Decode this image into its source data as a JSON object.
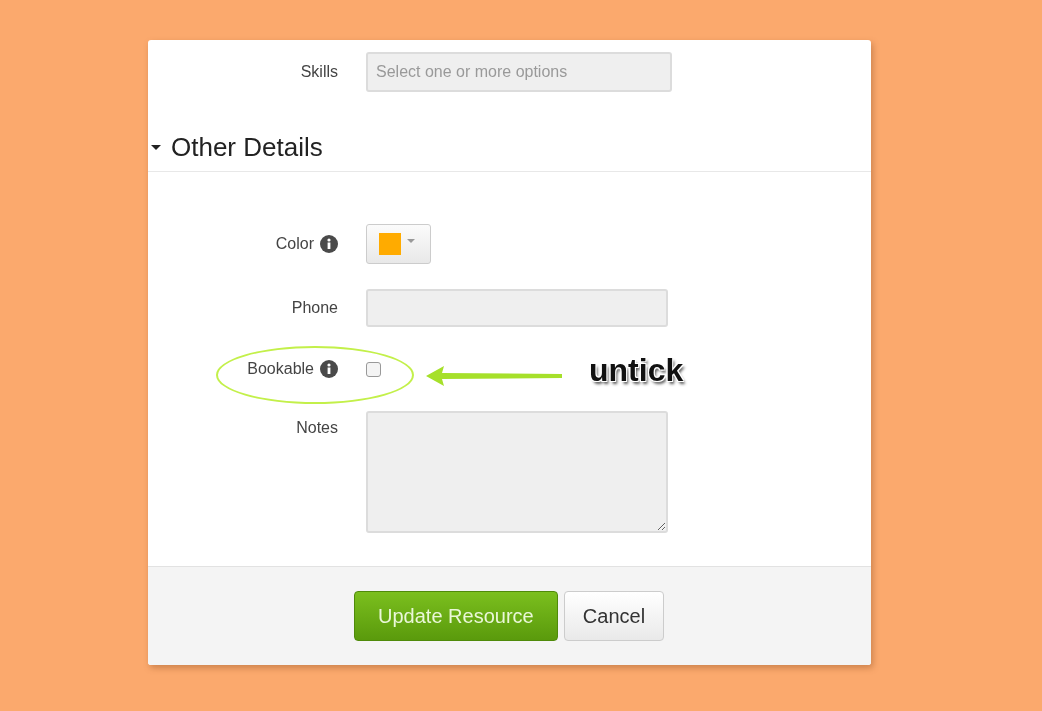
{
  "top_fields": [
    {
      "kind": "select",
      "label": "Skills",
      "placeholder": "Select one or more options"
    }
  ],
  "section": {
    "title": "Other Details",
    "expanded": true
  },
  "fields": [
    {
      "kind": "color",
      "label": "Color",
      "info": true,
      "color": "#ffab00"
    },
    {
      "kind": "text",
      "label": "Phone",
      "info": false
    },
    {
      "kind": "checkbox",
      "label": "Bookable",
      "info": true,
      "checked": false
    },
    {
      "kind": "textarea",
      "label": "Notes",
      "info": false
    }
  ],
  "buttons": [
    {
      "kind": "primary",
      "label": "Update Resource"
    },
    {
      "kind": "default",
      "label": "Cancel"
    }
  ],
  "annotation": {
    "text": "untick"
  }
}
